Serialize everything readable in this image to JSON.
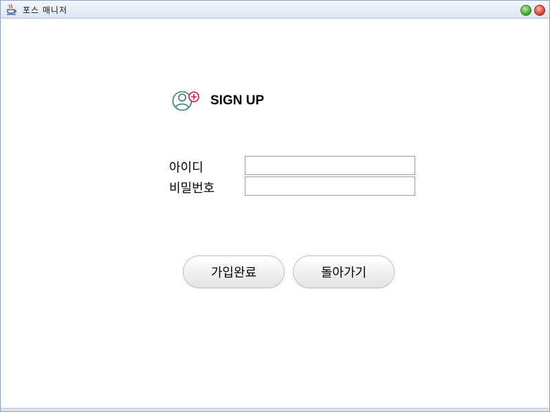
{
  "window": {
    "title": "포스 매니저",
    "app_icon": "java-cup-icon",
    "controls": [
      "minimize-icon",
      "close-icon"
    ]
  },
  "header": {
    "icon": "user-add-icon",
    "title": "SIGN UP",
    "icon_colors": {
      "person": "#3a7a6a",
      "plus": "#c0185a"
    }
  },
  "form": {
    "id_label": "아이디",
    "id_value": "",
    "password_label": "비밀번호",
    "password_value": ""
  },
  "buttons": {
    "join_label": "가입완료",
    "back_label": "돌아가기"
  }
}
